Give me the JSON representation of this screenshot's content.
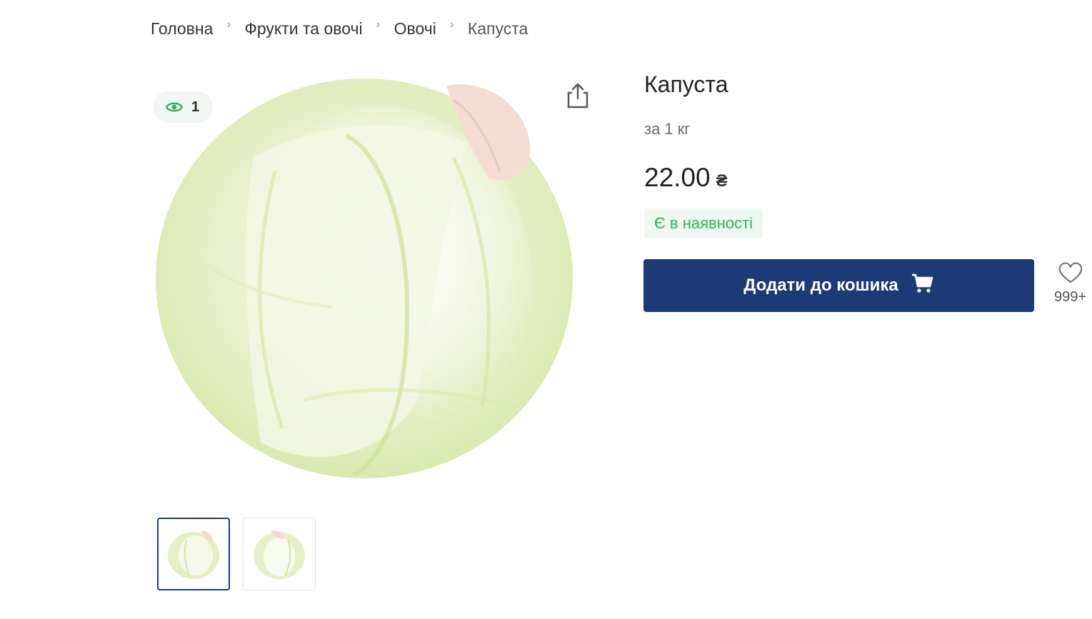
{
  "breadcrumb": {
    "items": [
      "Головна",
      "Фрукти та овочі",
      "Овочі"
    ],
    "current": "Капуста"
  },
  "gallery": {
    "views_count": "1",
    "main_image": "cabbage-photo",
    "thumbnails": [
      "cabbage-thumb-1",
      "cabbage-thumb-2"
    ],
    "active_thumbnail": 0
  },
  "product": {
    "title": "Капуста",
    "unit": "за 1 кг",
    "price": "22.00",
    "currency": "₴",
    "stock_status": "Є в наявності"
  },
  "actions": {
    "add_to_cart_label": "Додати до кошика",
    "favorites_count": "999+"
  },
  "icons": {
    "views": "eye-icon",
    "share": "share-icon",
    "cart": "cart-icon",
    "favorite": "heart-icon",
    "breadcrumb_separator": "chevron-right-icon"
  },
  "colors": {
    "primary_button": "#1c3b76",
    "stock_text": "#2fb25d",
    "stock_background": "#eef8f0",
    "views_icon": "#2fb25d",
    "views_background": "#f1f6f2"
  }
}
